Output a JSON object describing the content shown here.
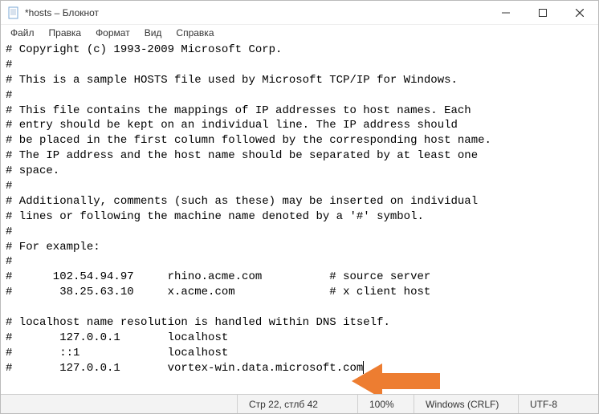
{
  "window": {
    "title": "*hosts – Блокнот"
  },
  "menu": {
    "file": "Файл",
    "edit": "Правка",
    "format": "Формат",
    "view": "Вид",
    "help": "Справка"
  },
  "content": "# Copyright (c) 1993-2009 Microsoft Corp.\n#\n# This is a sample HOSTS file used by Microsoft TCP/IP for Windows.\n#\n# This file contains the mappings of IP addresses to host names. Each\n# entry should be kept on an individual line. The IP address should\n# be placed in the first column followed by the corresponding host name.\n# The IP address and the host name should be separated by at least one\n# space.\n#\n# Additionally, comments (such as these) may be inserted on individual\n# lines or following the machine name denoted by a '#' symbol.\n#\n# For example:\n#\n#      102.54.94.97     rhino.acme.com          # source server\n#       38.25.63.10     x.acme.com              # x client host\n\n# localhost name resolution is handled within DNS itself.\n#       127.0.0.1       localhost\n#       ::1             localhost\n#       127.0.0.1       vortex-win.data.microsoft.com",
  "status": {
    "position": "Стр 22, стлб 42",
    "zoom": "100%",
    "line_ending": "Windows (CRLF)",
    "encoding": "UTF-8"
  }
}
